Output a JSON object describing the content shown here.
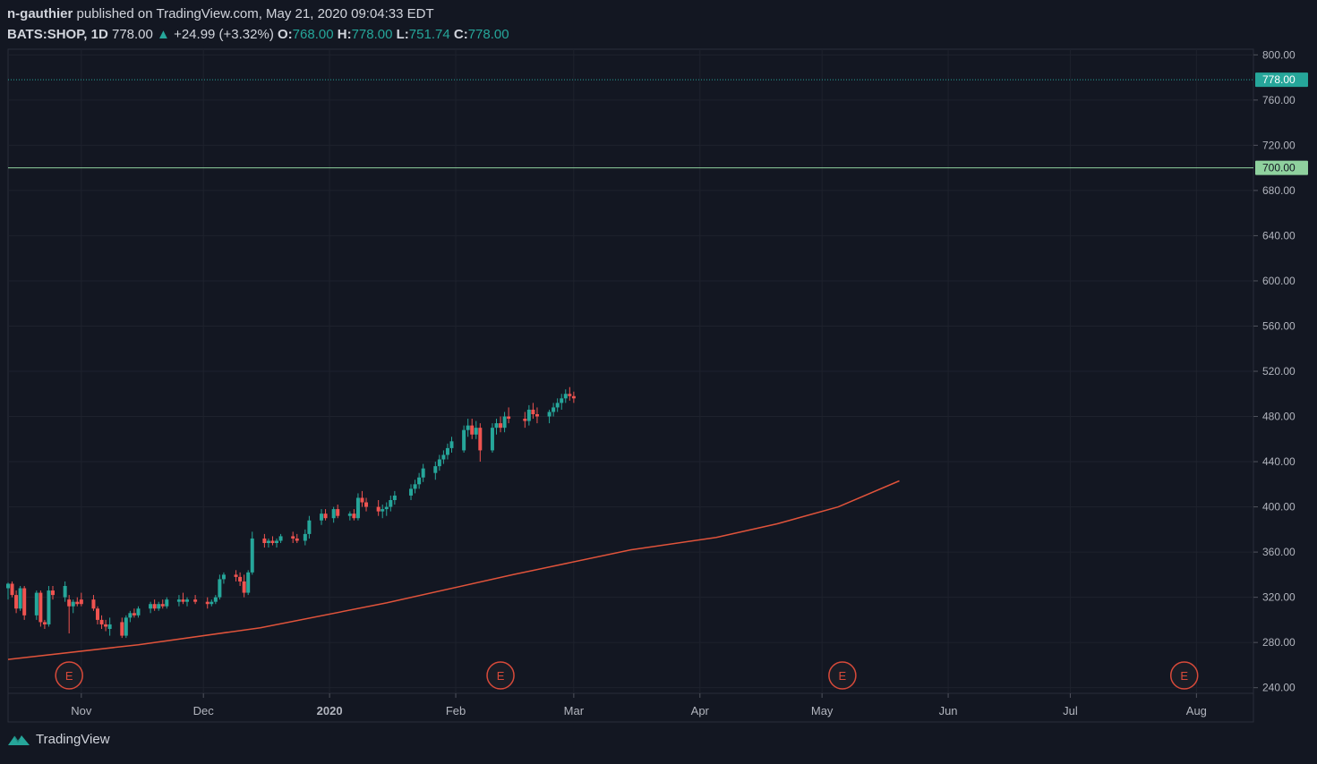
{
  "header": {
    "author": "n-gauthier",
    "published": "published on TradingView.com, May 21, 2020 09:04:33 EDT",
    "symbol": "BATS:SHOP, 1D",
    "last": "778.00",
    "arrow": "▲",
    "change": "+24.99 (+3.32%)",
    "o_label": "O:",
    "o": "768.00",
    "h_label": "H:",
    "h": "778.00",
    "l_label": "L:",
    "l": "751.74",
    "c_label": "C:",
    "c": "778.00"
  },
  "brand": "TradingView",
  "colors": {
    "background": "#131722",
    "up": "#26a69a",
    "down": "#ef5350",
    "ma": "#e0533b",
    "price_line": "#26a69a",
    "level_line": "#8fd19e",
    "earnings": "#d84a3a"
  },
  "chart_data": {
    "type": "candlestick",
    "title": "",
    "xlabel": "",
    "ylabel": "",
    "ylim": [
      235,
      805
    ],
    "y_ticks": [
      "240.00",
      "280.00",
      "320.00",
      "360.00",
      "400.00",
      "440.00",
      "480.00",
      "520.00",
      "560.00",
      "600.00",
      "640.00",
      "680.00",
      "720.00",
      "760.00",
      "800.00"
    ],
    "y_tick_values": [
      240,
      280,
      320,
      360,
      400,
      440,
      480,
      520,
      560,
      600,
      640,
      680,
      720,
      760,
      800
    ],
    "x_ticks": [
      {
        "label": "Nov",
        "date": "2019-11-01"
      },
      {
        "label": "Dec",
        "date": "2019-12-01"
      },
      {
        "label": "2020",
        "date": "2020-01-01"
      },
      {
        "label": "Feb",
        "date": "2020-02-01"
      },
      {
        "label": "Mar",
        "date": "2020-03-01"
      },
      {
        "label": "Apr",
        "date": "2020-04-01"
      },
      {
        "label": "May",
        "date": "2020-05-01"
      },
      {
        "label": "Jun",
        "date": "2020-06-01"
      },
      {
        "label": "Jul",
        "date": "2020-07-01"
      },
      {
        "label": "Aug",
        "date": "2020-08-01"
      }
    ],
    "x_range": [
      "2019-10-14",
      "2020-08-15"
    ],
    "price_badge": "778.00",
    "price_line_value": 778,
    "level_badge": "700.00",
    "level_value": 700,
    "earnings_markers": [
      {
        "label": "E",
        "date": "2019-10-29"
      },
      {
        "label": "E",
        "date": "2020-02-12"
      },
      {
        "label": "E",
        "date": "2020-05-06"
      },
      {
        "label": "E",
        "date": "2020-07-29"
      }
    ],
    "moving_average": [
      {
        "date": "2019-10-14",
        "value": 265
      },
      {
        "date": "2019-11-15",
        "value": 278
      },
      {
        "date": "2019-12-15",
        "value": 293
      },
      {
        "date": "2020-01-15",
        "value": 315
      },
      {
        "date": "2020-02-15",
        "value": 340
      },
      {
        "date": "2020-03-15",
        "value": 362
      },
      {
        "date": "2020-04-05",
        "value": 373
      },
      {
        "date": "2020-04-20",
        "value": 385
      },
      {
        "date": "2020-05-05",
        "value": 400
      },
      {
        "date": "2020-05-20",
        "value": 423
      }
    ],
    "candles": [
      {
        "date": "2019-10-14",
        "o": 328,
        "h": 333,
        "l": 318,
        "c": 332
      },
      {
        "date": "2019-10-15",
        "o": 332,
        "h": 334,
        "l": 320,
        "c": 322
      },
      {
        "date": "2019-10-16",
        "o": 322,
        "h": 326,
        "l": 306,
        "c": 310
      },
      {
        "date": "2019-10-17",
        "o": 310,
        "h": 330,
        "l": 308,
        "c": 328
      },
      {
        "date": "2019-10-18",
        "o": 328,
        "h": 330,
        "l": 300,
        "c": 304
      },
      {
        "date": "2019-10-21",
        "o": 304,
        "h": 326,
        "l": 300,
        "c": 324
      },
      {
        "date": "2019-10-22",
        "o": 324,
        "h": 326,
        "l": 294,
        "c": 298
      },
      {
        "date": "2019-10-23",
        "o": 298,
        "h": 300,
        "l": 292,
        "c": 296
      },
      {
        "date": "2019-10-24",
        "o": 296,
        "h": 330,
        "l": 294,
        "c": 326
      },
      {
        "date": "2019-10-25",
        "o": 326,
        "h": 330,
        "l": 318,
        "c": 322
      },
      {
        "date": "2019-10-28",
        "o": 320,
        "h": 334,
        "l": 316,
        "c": 330
      },
      {
        "date": "2019-10-29",
        "o": 318,
        "h": 322,
        "l": 288,
        "c": 312
      },
      {
        "date": "2019-10-30",
        "o": 312,
        "h": 318,
        "l": 306,
        "c": 316
      },
      {
        "date": "2019-10-31",
        "o": 316,
        "h": 320,
        "l": 312,
        "c": 314
      },
      {
        "date": "2019-11-01",
        "o": 318,
        "h": 324,
        "l": 312,
        "c": 314
      },
      {
        "date": "2019-11-04",
        "o": 318,
        "h": 322,
        "l": 308,
        "c": 310
      },
      {
        "date": "2019-11-05",
        "o": 310,
        "h": 312,
        "l": 296,
        "c": 300
      },
      {
        "date": "2019-11-06",
        "o": 300,
        "h": 304,
        "l": 292,
        "c": 296
      },
      {
        "date": "2019-11-07",
        "o": 296,
        "h": 300,
        "l": 290,
        "c": 294
      },
      {
        "date": "2019-11-08",
        "o": 292,
        "h": 302,
        "l": 286,
        "c": 296
      },
      {
        "date": "2019-11-11",
        "o": 298,
        "h": 302,
        "l": 284,
        "c": 286
      },
      {
        "date": "2019-11-12",
        "o": 286,
        "h": 304,
        "l": 284,
        "c": 302
      },
      {
        "date": "2019-11-13",
        "o": 302,
        "h": 308,
        "l": 298,
        "c": 306
      },
      {
        "date": "2019-11-14",
        "o": 306,
        "h": 310,
        "l": 302,
        "c": 304
      },
      {
        "date": "2019-11-15",
        "o": 304,
        "h": 312,
        "l": 302,
        "c": 310
      },
      {
        "date": "2019-11-18",
        "o": 310,
        "h": 316,
        "l": 306,
        "c": 314
      },
      {
        "date": "2019-11-19",
        "o": 314,
        "h": 318,
        "l": 308,
        "c": 310
      },
      {
        "date": "2019-11-20",
        "o": 310,
        "h": 316,
        "l": 308,
        "c": 314
      },
      {
        "date": "2019-11-21",
        "o": 314,
        "h": 318,
        "l": 310,
        "c": 312
      },
      {
        "date": "2019-11-22",
        "o": 312,
        "h": 320,
        "l": 310,
        "c": 318
      },
      {
        "date": "2019-11-25",
        "o": 316,
        "h": 322,
        "l": 312,
        "c": 318
      },
      {
        "date": "2019-11-26",
        "o": 318,
        "h": 324,
        "l": 314,
        "c": 316
      },
      {
        "date": "2019-11-27",
        "o": 316,
        "h": 320,
        "l": 312,
        "c": 318
      },
      {
        "date": "2019-11-29",
        "o": 318,
        "h": 322,
        "l": 314,
        "c": 316
      },
      {
        "date": "2019-12-02",
        "o": 316,
        "h": 320,
        "l": 310,
        "c": 314
      },
      {
        "date": "2019-12-03",
        "o": 314,
        "h": 318,
        "l": 312,
        "c": 316
      },
      {
        "date": "2019-12-04",
        "o": 316,
        "h": 322,
        "l": 314,
        "c": 320
      },
      {
        "date": "2019-12-05",
        "o": 320,
        "h": 340,
        "l": 318,
        "c": 336
      },
      {
        "date": "2019-12-06",
        "o": 336,
        "h": 342,
        "l": 332,
        "c": 340
      },
      {
        "date": "2019-12-09",
        "o": 340,
        "h": 344,
        "l": 334,
        "c": 338
      },
      {
        "date": "2019-12-10",
        "o": 338,
        "h": 342,
        "l": 330,
        "c": 334
      },
      {
        "date": "2019-12-11",
        "o": 334,
        "h": 340,
        "l": 320,
        "c": 324
      },
      {
        "date": "2019-12-12",
        "o": 324,
        "h": 344,
        "l": 322,
        "c": 342
      },
      {
        "date": "2019-12-13",
        "o": 342,
        "h": 378,
        "l": 340,
        "c": 372
      },
      {
        "date": "2019-12-16",
        "o": 372,
        "h": 376,
        "l": 364,
        "c": 368
      },
      {
        "date": "2019-12-17",
        "o": 368,
        "h": 372,
        "l": 364,
        "c": 370
      },
      {
        "date": "2019-12-18",
        "o": 370,
        "h": 374,
        "l": 366,
        "c": 368
      },
      {
        "date": "2019-12-19",
        "o": 368,
        "h": 372,
        "l": 364,
        "c": 370
      },
      {
        "date": "2019-12-20",
        "o": 370,
        "h": 376,
        "l": 368,
        "c": 374
      },
      {
        "date": "2019-12-23",
        "o": 374,
        "h": 378,
        "l": 368,
        "c": 372
      },
      {
        "date": "2019-12-24",
        "o": 372,
        "h": 376,
        "l": 368,
        "c": 370
      },
      {
        "date": "2019-12-26",
        "o": 370,
        "h": 380,
        "l": 366,
        "c": 376
      },
      {
        "date": "2019-12-27",
        "o": 376,
        "h": 392,
        "l": 372,
        "c": 388
      },
      {
        "date": "2019-12-30",
        "o": 388,
        "h": 398,
        "l": 384,
        "c": 394
      },
      {
        "date": "2019-12-31",
        "o": 394,
        "h": 398,
        "l": 388,
        "c": 390
      },
      {
        "date": "2020-01-02",
        "o": 390,
        "h": 400,
        "l": 386,
        "c": 398
      },
      {
        "date": "2020-01-03",
        "o": 398,
        "h": 402,
        "l": 390,
        "c": 392
      },
      {
        "date": "2020-01-06",
        "o": 392,
        "h": 396,
        "l": 388,
        "c": 394
      },
      {
        "date": "2020-01-07",
        "o": 394,
        "h": 398,
        "l": 388,
        "c": 390
      },
      {
        "date": "2020-01-08",
        "o": 390,
        "h": 412,
        "l": 388,
        "c": 408
      },
      {
        "date": "2020-01-09",
        "o": 408,
        "h": 414,
        "l": 400,
        "c": 404
      },
      {
        "date": "2020-01-10",
        "o": 404,
        "h": 408,
        "l": 396,
        "c": 400
      },
      {
        "date": "2020-01-13",
        "o": 400,
        "h": 406,
        "l": 392,
        "c": 396
      },
      {
        "date": "2020-01-14",
        "o": 396,
        "h": 402,
        "l": 390,
        "c": 398
      },
      {
        "date": "2020-01-15",
        "o": 398,
        "h": 404,
        "l": 392,
        "c": 400
      },
      {
        "date": "2020-01-16",
        "o": 400,
        "h": 410,
        "l": 396,
        "c": 406
      },
      {
        "date": "2020-01-17",
        "o": 406,
        "h": 414,
        "l": 402,
        "c": 410
      },
      {
        "date": "2020-01-21",
        "o": 410,
        "h": 420,
        "l": 406,
        "c": 416
      },
      {
        "date": "2020-01-22",
        "o": 416,
        "h": 424,
        "l": 412,
        "c": 420
      },
      {
        "date": "2020-01-23",
        "o": 420,
        "h": 430,
        "l": 416,
        "c": 426
      },
      {
        "date": "2020-01-24",
        "o": 426,
        "h": 438,
        "l": 422,
        "c": 434
      },
      {
        "date": "2020-01-27",
        "o": 430,
        "h": 440,
        "l": 424,
        "c": 436
      },
      {
        "date": "2020-01-28",
        "o": 436,
        "h": 446,
        "l": 432,
        "c": 442
      },
      {
        "date": "2020-01-29",
        "o": 442,
        "h": 450,
        "l": 438,
        "c": 446
      },
      {
        "date": "2020-01-30",
        "o": 446,
        "h": 456,
        "l": 442,
        "c": 452
      },
      {
        "date": "2020-01-31",
        "o": 452,
        "h": 462,
        "l": 448,
        "c": 458
      },
      {
        "date": "2020-02-03",
        "o": 450,
        "h": 472,
        "l": 448,
        "c": 468
      },
      {
        "date": "2020-02-04",
        "o": 468,
        "h": 478,
        "l": 462,
        "c": 472
      },
      {
        "date": "2020-02-05",
        "o": 472,
        "h": 478,
        "l": 460,
        "c": 464
      },
      {
        "date": "2020-02-06",
        "o": 464,
        "h": 476,
        "l": 460,
        "c": 470
      },
      {
        "date": "2020-02-07",
        "o": 470,
        "h": 474,
        "l": 440,
        "c": 450
      },
      {
        "date": "2020-02-10",
        "o": 450,
        "h": 474,
        "l": 448,
        "c": 470
      },
      {
        "date": "2020-02-11",
        "o": 470,
        "h": 478,
        "l": 464,
        "c": 474
      },
      {
        "date": "2020-02-12",
        "o": 474,
        "h": 480,
        "l": 466,
        "c": 470
      },
      {
        "date": "2020-02-13",
        "o": 470,
        "h": 484,
        "l": 466,
        "c": 480
      },
      {
        "date": "2020-02-14",
        "o": 480,
        "h": 488,
        "l": 474,
        "c": 478
      },
      {
        "date": "2020-02-18",
        "o": 478,
        "h": 484,
        "l": 470,
        "c": 476
      },
      {
        "date": "2020-02-19",
        "o": 476,
        "h": 490,
        "l": 472,
        "c": 486
      },
      {
        "date": "2020-02-20",
        "o": 486,
        "h": 492,
        "l": 478,
        "c": 482
      },
      {
        "date": "2020-02-21",
        "o": 482,
        "h": 488,
        "l": 474,
        "c": 480
      },
      {
        "date": "2020-02-24",
        "o": 480,
        "h": 486,
        "l": 474,
        "c": 484
      },
      {
        "date": "2020-02-25",
        "o": 484,
        "h": 492,
        "l": 480,
        "c": 488
      },
      {
        "date": "2020-02-26",
        "o": 488,
        "h": 496,
        "l": 484,
        "c": 492
      },
      {
        "date": "2020-02-27",
        "o": 492,
        "h": 500,
        "l": 486,
        "c": 496
      },
      {
        "date": "2020-02-28",
        "o": 496,
        "h": 504,
        "l": 492,
        "c": 500
      },
      {
        "date": "2020-02-29",
        "o": 500,
        "h": 506,
        "l": 494,
        "c": 498
      },
      {
        "date": "2020-03-01",
        "o": 498,
        "h": 502,
        "l": 492,
        "c": 496
      }
    ],
    "volume": []
  }
}
